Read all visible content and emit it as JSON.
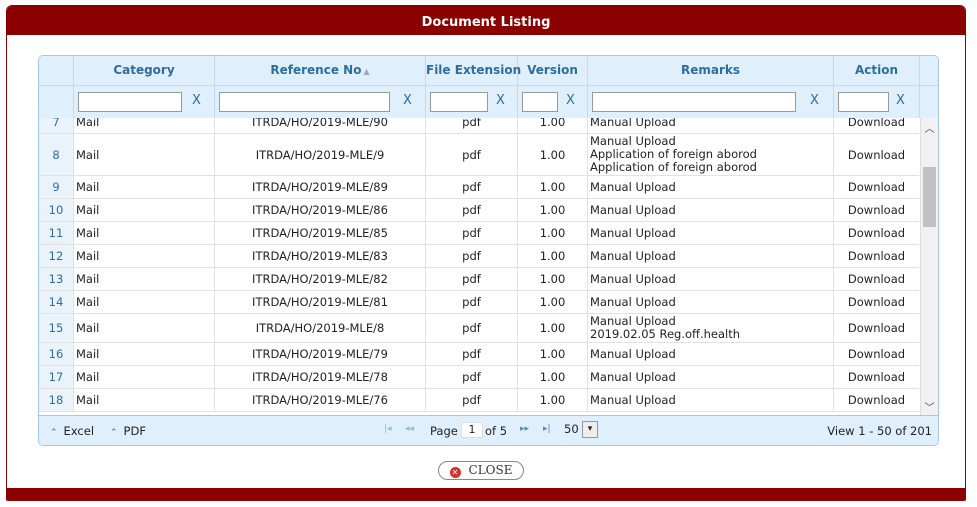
{
  "dialog": {
    "title": "Document Listing",
    "close_label": "CLOSE",
    "close_icon": "x-circle-icon"
  },
  "columns": {
    "category": "Category",
    "reference": "Reference No",
    "extension": "File Extension",
    "version": "Version",
    "remarks": "Remarks",
    "action": "Action"
  },
  "filter": {
    "clear_label": "X"
  },
  "rows": [
    {
      "num": "7",
      "category": "Mail",
      "ref": "ITRDA/HO/2019-MLE/90",
      "ext": "pdf",
      "version": "1.00",
      "remarks": [
        "Manual Upload"
      ],
      "action": "Download"
    },
    {
      "num": "8",
      "category": "Mail",
      "ref": "ITRDA/HO/2019-MLE/9",
      "ext": "pdf",
      "version": "1.00",
      "remarks": [
        "Manual Upload",
        "Application of foreign aborod",
        "Application of foreign aborod"
      ],
      "action": "Download"
    },
    {
      "num": "9",
      "category": "Mail",
      "ref": "ITRDA/HO/2019-MLE/89",
      "ext": "pdf",
      "version": "1.00",
      "remarks": [
        "Manual Upload"
      ],
      "action": "Download"
    },
    {
      "num": "10",
      "category": "Mail",
      "ref": "ITRDA/HO/2019-MLE/86",
      "ext": "pdf",
      "version": "1.00",
      "remarks": [
        "Manual Upload"
      ],
      "action": "Download"
    },
    {
      "num": "11",
      "category": "Mail",
      "ref": "ITRDA/HO/2019-MLE/85",
      "ext": "pdf",
      "version": "1.00",
      "remarks": [
        "Manual Upload"
      ],
      "action": "Download"
    },
    {
      "num": "12",
      "category": "Mail",
      "ref": "ITRDA/HO/2019-MLE/83",
      "ext": "pdf",
      "version": "1.00",
      "remarks": [
        "Manual Upload"
      ],
      "action": "Download"
    },
    {
      "num": "13",
      "category": "Mail",
      "ref": "ITRDA/HO/2019-MLE/82",
      "ext": "pdf",
      "version": "1.00",
      "remarks": [
        "Manual Upload"
      ],
      "action": "Download"
    },
    {
      "num": "14",
      "category": "Mail",
      "ref": "ITRDA/HO/2019-MLE/81",
      "ext": "pdf",
      "version": "1.00",
      "remarks": [
        "Manual Upload"
      ],
      "action": "Download"
    },
    {
      "num": "15",
      "category": "Mail",
      "ref": "ITRDA/HO/2019-MLE/8",
      "ext": "pdf",
      "version": "1.00",
      "remarks": [
        "Manual Upload",
        "2019.02.05 Reg.off.health"
      ],
      "action": "Download"
    },
    {
      "num": "16",
      "category": "Mail",
      "ref": "ITRDA/HO/2019-MLE/79",
      "ext": "pdf",
      "version": "1.00",
      "remarks": [
        "Manual Upload"
      ],
      "action": "Download"
    },
    {
      "num": "17",
      "category": "Mail",
      "ref": "ITRDA/HO/2019-MLE/78",
      "ext": "pdf",
      "version": "1.00",
      "remarks": [
        "Manual Upload"
      ],
      "action": "Download"
    },
    {
      "num": "18",
      "category": "Mail",
      "ref": "ITRDA/HO/2019-MLE/76",
      "ext": "pdf",
      "version": "1.00",
      "remarks": [
        "Manual Upload"
      ],
      "action": "Download"
    }
  ],
  "pager": {
    "excel_label": "Excel",
    "pdf_label": "PDF",
    "page_label": "Page",
    "page_value": "1",
    "of_label": "of 5",
    "page_size": "50",
    "view_text": "View 1 - 50 of 201"
  }
}
